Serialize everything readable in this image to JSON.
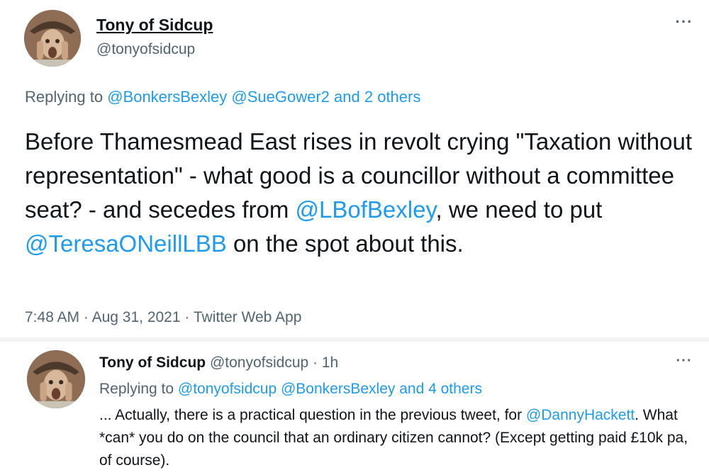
{
  "main_tweet": {
    "author_name": "Tony of Sidcup",
    "author_handle": "@tonyofsidcup",
    "more_label": "···",
    "replying_prefix": "Replying to",
    "replying_to": [
      "@BonkersBexley",
      "@SueGower2"
    ],
    "replying_others": "and 2 others",
    "body": {
      "part1": "Before Thamesmead East rises in revolt crying \"Taxation without representation\" - what good is a councillor without a committee seat? - and secedes from ",
      "mention1": "@LBofBexley",
      "part2": ", we need to put ",
      "mention2": "@TeresaONeillLBB",
      "part3": " on the spot about this."
    },
    "time": "7:48 AM",
    "date": "Aug 31, 2021",
    "source": "Twitter Web App",
    "sep": "·"
  },
  "reply_tweet": {
    "author_name": "Tony of Sidcup",
    "author_handle": "@tonyofsidcup",
    "sep": "·",
    "age": "1h",
    "more_label": "···",
    "replying_prefix": "Replying to",
    "replying_to": [
      "@tonyofsidcup",
      "@BonkersBexley"
    ],
    "replying_others": "and 4 others",
    "body": {
      "part1": "... Actually, there is a practical question in the previous tweet, for ",
      "mention1": "@DannyHackett",
      "part2": ". What *can* you do on the council that an ordinary citizen cannot? (Except getting paid £10k pa, of course)."
    }
  },
  "colors": {
    "link": "#1d9bf0",
    "text": "#0f1419",
    "muted": "#536471"
  },
  "icons": {
    "avatar": "avatar-photo",
    "more": "more-options-icon"
  }
}
